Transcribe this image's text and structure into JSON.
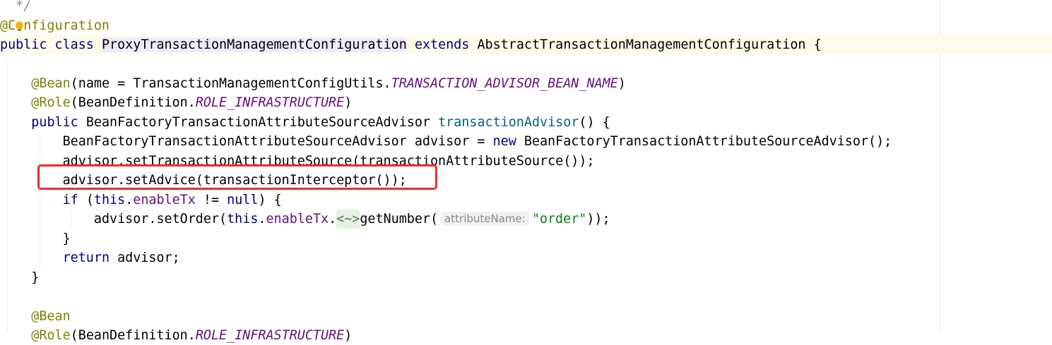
{
  "editor": {
    "language": "java",
    "colors": {
      "keyword": "#000080",
      "annotation": "#808000",
      "constant": "#660e7a",
      "method_declaration": "#00627a",
      "string": "#067d17",
      "highlight_box": "#ef2c2c",
      "current_line": "#fffbe9"
    },
    "gutter_icon": "lightbulb-icon",
    "lines": {
      "l0": {
        "comment": "*/"
      },
      "l1": {
        "annotation": "@Configuration"
      },
      "l2": {
        "kw1": "public",
        "kw2": "class",
        "class_name": "ProxyTransactionManagementConfiguration",
        "kw3": "extends",
        "super_class": "AbstractTransactionManagementConfiguration",
        "brace": "{"
      },
      "l4": {
        "annotation": "@Bean",
        "args_start": "(name = TransactionManagementConfigUtils.",
        "constant": "TRANSACTION_ADVISOR_BEAN_NAME",
        "args_end": ")"
      },
      "l5": {
        "annotation": "@Role",
        "args_start": "(BeanDefinition.",
        "constant": "ROLE_INFRASTRUCTURE",
        "args_end": ")"
      },
      "l6": {
        "kw": "public",
        "return_type": "BeanFactoryTransactionAttributeSourceAdvisor",
        "method": "transactionAdvisor",
        "rest": "() {"
      },
      "l7": {
        "decl": "BeanFactoryTransactionAttributeSourceAdvisor advisor = ",
        "kw": "new",
        "rest": "BeanFactoryTransactionAttributeSourceAdvisor();"
      },
      "l8": {
        "code": "advisor.setTransactionAttributeSource(transactionAttributeSource());"
      },
      "l9": {
        "code": "advisor.setAdvice(transactionInterceptor());"
      },
      "l10": {
        "kw": "if",
        "paren": "(",
        "this_kw": "this",
        "dot": ".",
        "field": "enableTx",
        "op": " != ",
        "null_kw": "null",
        "rest": ") {"
      },
      "l11": {
        "call": "advisor.setOrder(",
        "this_kw": "this",
        "dot": ".",
        "field": "enableTx",
        "dot2": ".",
        "folded": "<~>",
        "method": "getNumber(",
        "hint": "attributeName:",
        "str": "\"order\"",
        "rest": "));"
      },
      "l12": {
        "code": "}"
      },
      "l13": {
        "kw": "return",
        "rest": "advisor;"
      },
      "l14": {
        "code": "}"
      },
      "l16": {
        "annotation": "@Bean"
      },
      "l17": {
        "annotation": "@Role",
        "args_start": "(BeanDefinition.",
        "constant": "ROLE_INFRASTRUCTURE",
        "args_end": ")"
      }
    }
  }
}
